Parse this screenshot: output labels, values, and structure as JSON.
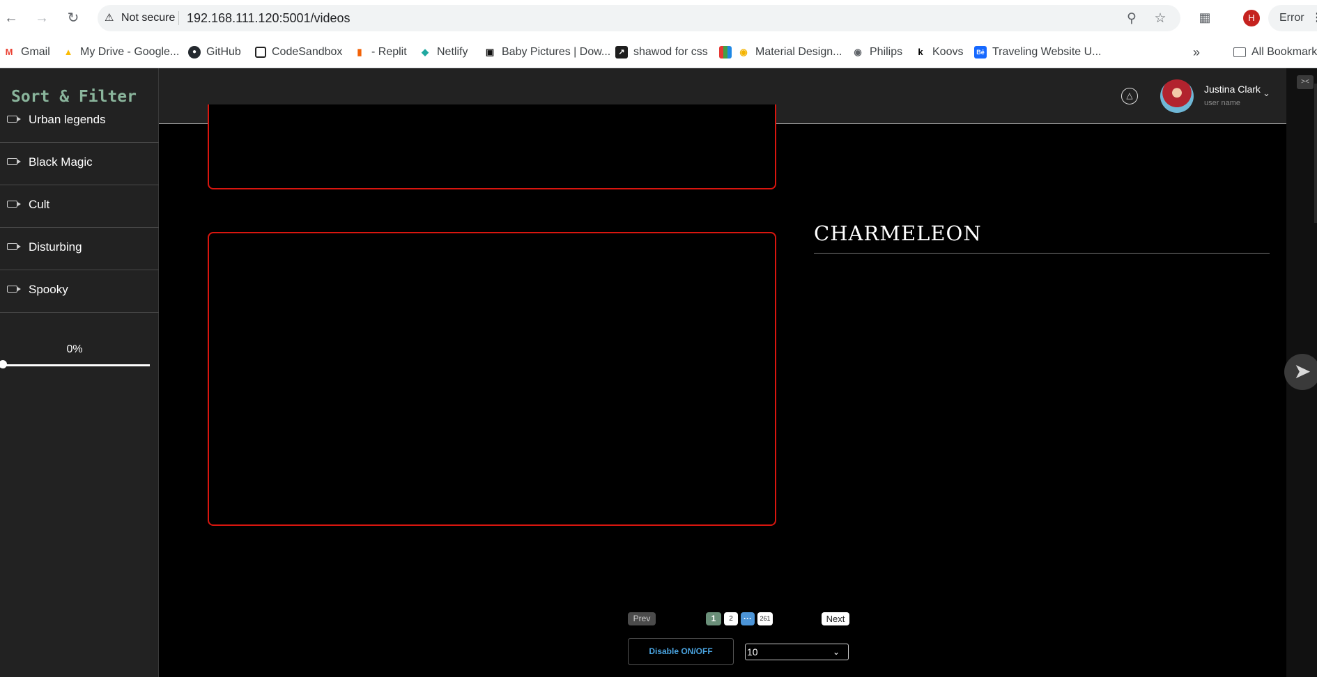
{
  "browser": {
    "security_label": "Not secure",
    "url": "192.168.111.120:5001/videos",
    "profile_initial": "H",
    "error_label": "Error",
    "bookmarks": [
      {
        "label": "Gmail",
        "icon": "gmail-icon"
      },
      {
        "label": "My Drive - Google...",
        "icon": "google-drive-icon"
      },
      {
        "label": "GitHub",
        "icon": "github-icon"
      },
      {
        "label": "CodeSandbox",
        "icon": "codesandbox-icon"
      },
      {
        "label": "- Replit",
        "icon": "replit-icon"
      },
      {
        "label": "Netlify",
        "icon": "netlify-icon"
      },
      {
        "label": "Baby Pictures | Dow...",
        "icon": "baby-pictures-icon"
      },
      {
        "label": "shawod for css",
        "icon": "cursor-icon"
      },
      {
        "label": "Material Design...",
        "icon": "material-design-icon"
      },
      {
        "label": "Philips",
        "icon": "globe-icon"
      },
      {
        "label": "Koovs",
        "icon": "koovs-icon"
      },
      {
        "label": "Traveling Website U...",
        "icon": "behance-icon"
      }
    ],
    "all_bookmarks_label": "All Bookmarks"
  },
  "sidebar": {
    "title": "Sort & Filter",
    "categories": [
      {
        "label": "Urban legends"
      },
      {
        "label": "Black Magic"
      },
      {
        "label": "Cult"
      },
      {
        "label": "Disturbing"
      },
      {
        "label": "Spooky"
      }
    ],
    "progress_label": "0%",
    "progress_value": 0
  },
  "header": {
    "user_name": "Justina Clark",
    "user_role": "user name"
  },
  "main": {
    "video_title": "CHARMELEON"
  },
  "pagination": {
    "prev_label": "Prev",
    "next_label": "Next",
    "pages": [
      "1",
      "2",
      "···",
      "261"
    ],
    "current_page": "1"
  },
  "controls": {
    "disable_label": "Disable ON/OFF",
    "page_size": "10"
  },
  "colors": {
    "frame_border": "#d9160f",
    "sidebar_title": "#8ab59c",
    "active_page": "#6a8f79",
    "dots_page": "#4c95d8",
    "disable_text": "#4aa3df"
  }
}
